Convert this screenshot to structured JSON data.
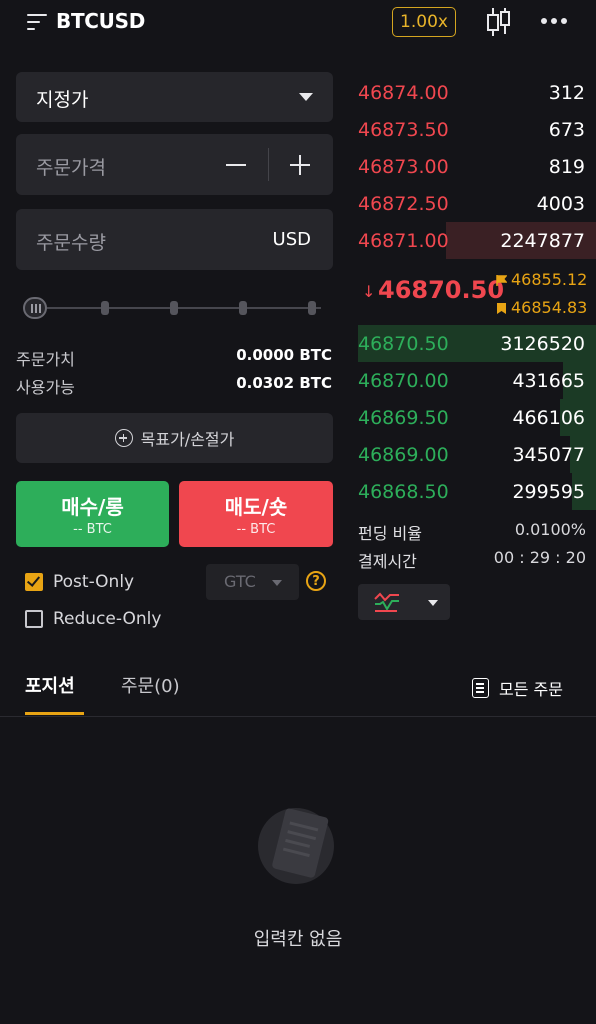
{
  "header": {
    "symbol": "BTCUSD",
    "leverage": "1.00x",
    "icons": [
      "menu-icon",
      "candlestick-chart-icon",
      "more-icon"
    ]
  },
  "order_form": {
    "order_type": "지정가",
    "price_placeholder": "주문가격",
    "qty_placeholder": "주문수량",
    "qty_unit": "USD",
    "order_value_label": "주문가치",
    "order_value": "0.0000 BTC",
    "available_label": "사용가능",
    "available": "0.0302 BTC",
    "tpsl_label": "목표가/손절가",
    "buy_label": "매수/롱",
    "buy_sub": "-- BTC",
    "sell_label": "매도/숏",
    "sell_sub": "-- BTC",
    "post_only_label": "Post-Only",
    "post_only_checked": true,
    "reduce_only_label": "Reduce-Only",
    "reduce_only_checked": false,
    "time_in_force": "GTC",
    "help_glyph": "?"
  },
  "orderbook": {
    "asks": [
      {
        "price": "46874.00",
        "qty": "312",
        "depth": 0
      },
      {
        "price": "46873.50",
        "qty": "673",
        "depth": 0
      },
      {
        "price": "46873.00",
        "qty": "819",
        "depth": 0
      },
      {
        "price": "46872.50",
        "qty": "4003",
        "depth": 0
      },
      {
        "price": "46871.00",
        "qty": "2247877",
        "depth": 0.63
      }
    ],
    "last_price": "46870.50",
    "last_direction": "down",
    "mark_price": "46855.12",
    "index_price": "46854.83",
    "bids": [
      {
        "price": "46870.50",
        "qty": "3126520",
        "depth": 1.0
      },
      {
        "price": "46870.00",
        "qty": "431665",
        "depth": 0.14
      },
      {
        "price": "46869.50",
        "qty": "466106",
        "depth": 0.15
      },
      {
        "price": "46869.00",
        "qty": "345077",
        "depth": 0.11
      },
      {
        "price": "46868.50",
        "qty": "299595",
        "depth": 0.1
      }
    ],
    "funding_label": "펀딩 비율",
    "funding_rate": "0.0100%",
    "settle_label": "결제시간",
    "settle_time": "00 : 29 : 20"
  },
  "tabs": [
    {
      "label": "포지션",
      "active": true
    },
    {
      "label": "주문(0)",
      "active": false
    }
  ],
  "all_orders_label": "모든 주문",
  "empty_text": "입력칸 없음",
  "colors": {
    "background": "#141418",
    "panel": "#26262b",
    "accent": "#e8a414",
    "buy": "#2dae5a",
    "sell": "#f0474f"
  }
}
